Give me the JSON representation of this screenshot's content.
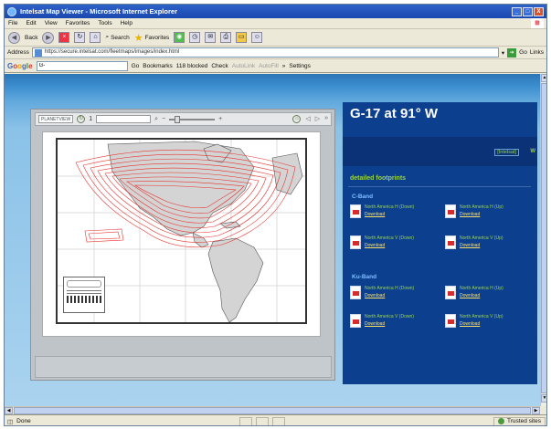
{
  "window": {
    "title": "Intelsat Map Viewer - Microsoft Internet Explorer",
    "minimize": "_",
    "maximize": "□",
    "close": "X"
  },
  "menu": {
    "items": [
      "File",
      "Edit",
      "View",
      "Favorites",
      "Tools",
      "Help"
    ]
  },
  "toolbar": {
    "back_label": "Back",
    "search_label": "Search",
    "favorites_label": "Favorites"
  },
  "address": {
    "label": "Address",
    "url": "https://secure.intelsat.com/fleetmaps/images/index.html",
    "go_label": "Go",
    "links_label": "Links"
  },
  "googlebar": {
    "input_value": "G-",
    "go_label": "Go",
    "bookmarks_label": "Bookmarks",
    "popups_label": "118 blocked",
    "check_label": "Check",
    "autolink_label": "AutoLink",
    "autofill_label": "AutoFill",
    "more_label": "»",
    "settings_label": "Settings"
  },
  "viewer": {
    "brand_label": "PLANETVIEW",
    "page_indicator": "1",
    "zoom_minus": "−",
    "zoom_plus": "+",
    "nav_prev": "◁",
    "nav_next": "▷",
    "nav_more": "»"
  },
  "satellite": {
    "title": "G-17 at 91° W",
    "banner_link": "[Intelsat]",
    "banner_tail": "W",
    "detailed_heading": "detailed footprints"
  },
  "bands": [
    {
      "name": "C-Band",
      "downloads": [
        {
          "name": "North America H (Down)",
          "link": "Download"
        },
        {
          "name": "North America H (Up)",
          "link": "Download"
        },
        {
          "name": "North America V (Down)",
          "link": "Download"
        },
        {
          "name": "North America V (Up)",
          "link": "Download"
        }
      ]
    },
    {
      "name": "Ku-Band",
      "downloads": [
        {
          "name": "North America H (Down)",
          "link": "Download"
        },
        {
          "name": "North America H (Up)",
          "link": "Download"
        },
        {
          "name": "North America V (Down)",
          "link": "Download"
        },
        {
          "name": "North America V (Up)",
          "link": "Download"
        }
      ]
    }
  ],
  "status": {
    "left": "Done",
    "zone": "Trusted sites"
  },
  "colors": {
    "footprint": "#e8322e",
    "panel_bg": "#0d3f8f",
    "accent_green": "#9ad34a"
  },
  "icons": [
    "ie-icon",
    "back-icon",
    "forward-icon",
    "stop-icon",
    "refresh-icon",
    "home-icon",
    "search-icon",
    "favorites-icon",
    "media-icon",
    "mail-icon",
    "print-icon",
    "folder-icon",
    "pdf-icon"
  ]
}
